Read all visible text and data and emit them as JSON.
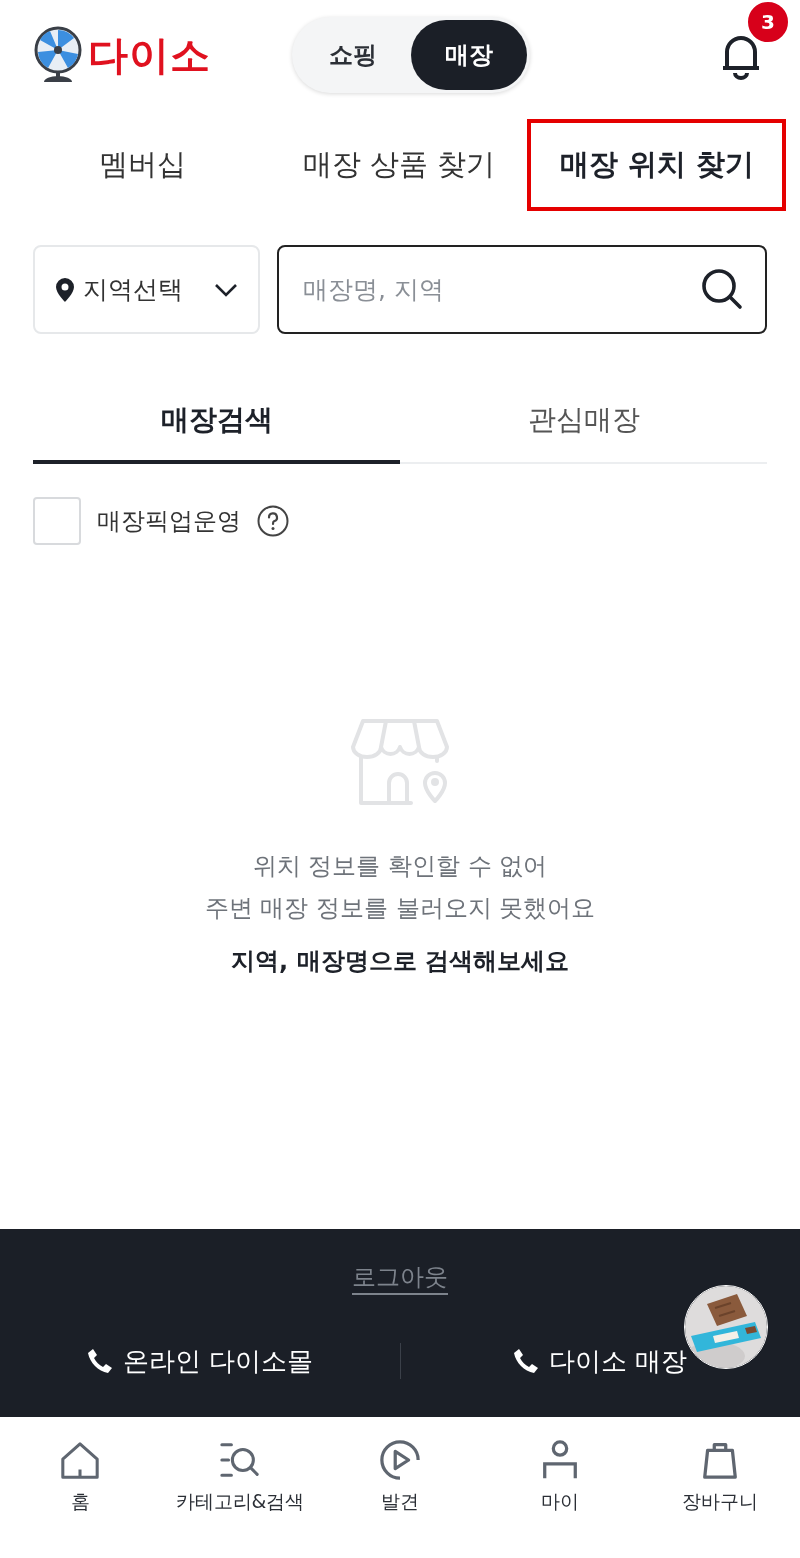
{
  "header": {
    "logo_text": "다이소",
    "mode_toggle": [
      {
        "label": "쇼핑",
        "selected": false
      },
      {
        "label": "매장",
        "selected": true
      }
    ],
    "notification_count": "3"
  },
  "subnav": [
    {
      "label": "멤버십",
      "selected": false,
      "highlighted": false
    },
    {
      "label": "매장 상품 찾기",
      "selected": false,
      "highlighted": false
    },
    {
      "label": "매장 위치 찾기",
      "selected": true,
      "highlighted": true
    }
  ],
  "search": {
    "region_select": "지역선택",
    "placeholder": "매장명, 지역"
  },
  "tabs": [
    {
      "label": "매장검색",
      "selected": true
    },
    {
      "label": "관심매장",
      "selected": false
    }
  ],
  "pickup_filter": {
    "label": "매장픽업운영",
    "checked": false
  },
  "empty_state": {
    "lines": [
      "위치 정보를 확인할 수 없어",
      "주변 매장 정보를 불러오지 못했어요"
    ],
    "hint": "지역, 매장명으로 검색해보세요"
  },
  "footer": {
    "logout": "로그아웃",
    "contacts": [
      "온라인 다이소몰",
      "다이소 매장"
    ]
  },
  "bottom_nav": [
    {
      "label": "홈",
      "kind": "home"
    },
    {
      "label": "카테고리&검색",
      "kind": "category"
    },
    {
      "label": "발견",
      "kind": "discover"
    },
    {
      "label": "마이",
      "kind": "my"
    },
    {
      "label": "장바구니",
      "kind": "cart"
    }
  ]
}
